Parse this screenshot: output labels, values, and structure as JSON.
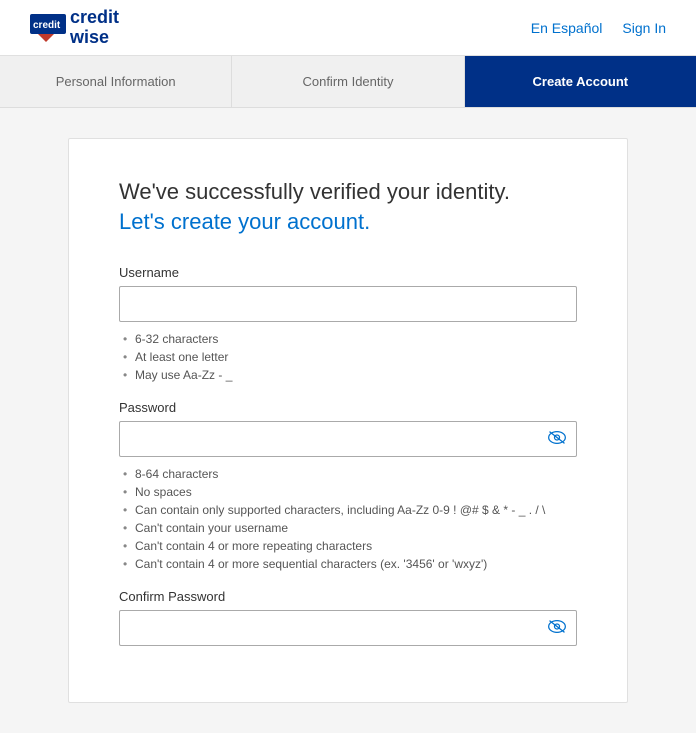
{
  "header": {
    "logo_text_1": "credit",
    "logo_text_2": "wise",
    "link_espanol": "En Español",
    "link_signin": "Sign In"
  },
  "steps": [
    {
      "label": "Personal Information",
      "active": false
    },
    {
      "label": "Confirm Identity",
      "active": false
    },
    {
      "label": "Create Account",
      "active": true
    }
  ],
  "card": {
    "title_line1": "We've successfully verified your identity.",
    "title_line2": "Let's create your account.",
    "username_label": "Username",
    "username_placeholder": "",
    "username_rules": [
      "6-32 characters",
      "At least one letter",
      "May use Aa-Zz - _"
    ],
    "password_label": "Password",
    "password_placeholder": "",
    "password_rules": [
      "8-64 characters",
      "No spaces",
      "Can contain only supported characters, including Aa-Zz 0-9 ! @# $ & * - _ . / \\",
      "Can't contain your username",
      "Can't contain 4 or more repeating characters",
      "Can't contain 4 or more sequential characters (ex. '3456' or 'wxyz')"
    ],
    "confirm_password_label": "Confirm Password",
    "confirm_password_placeholder": ""
  }
}
